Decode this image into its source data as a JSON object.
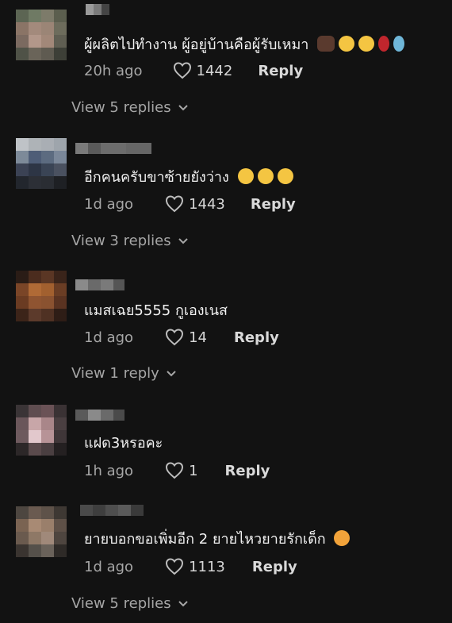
{
  "comments": [
    {
      "text": "ผู้ผลิตไปทำงาน ผู้อยู่บ้านคือผู้รับเหมา",
      "time": "20h ago",
      "likes": "1442",
      "reply": "Reply",
      "view_replies": "View 5 replies",
      "emojis": [
        "flexed-biceps-icon",
        "grinning-icon",
        "sweat-smile-icon",
        "rose-icon",
        "unicorn-icon"
      ]
    },
    {
      "text": "อีกคนครับขาซ้ายยังว่าง",
      "time": "1d ago",
      "likes": "1443",
      "reply": "Reply",
      "view_replies": "View 3 replies",
      "emojis": [
        "sweat-smile-icon",
        "laughing-icon",
        "grinning-icon"
      ]
    },
    {
      "text": "แมสเฉย5555 กูเองเนส",
      "time": "1d ago",
      "likes": "14",
      "reply": "Reply",
      "view_replies": "View 1 reply",
      "emojis": []
    },
    {
      "text": "แฝด3หรอคะ",
      "time": "1h ago",
      "likes": "1",
      "reply": "Reply",
      "view_replies": "",
      "emojis": []
    },
    {
      "text": "ยายบอกขอเพิ่มอีก 2 ยายไหวยายรักเด็ก",
      "time": "1d ago",
      "likes": "1113",
      "reply": "Reply",
      "view_replies": "View 5 replies",
      "emojis": [
        "crying-laughing-cat-icon"
      ]
    }
  ],
  "colors": {
    "background": "#121212",
    "text": "#f1f1f1",
    "secondary": "#a6a6a6"
  }
}
